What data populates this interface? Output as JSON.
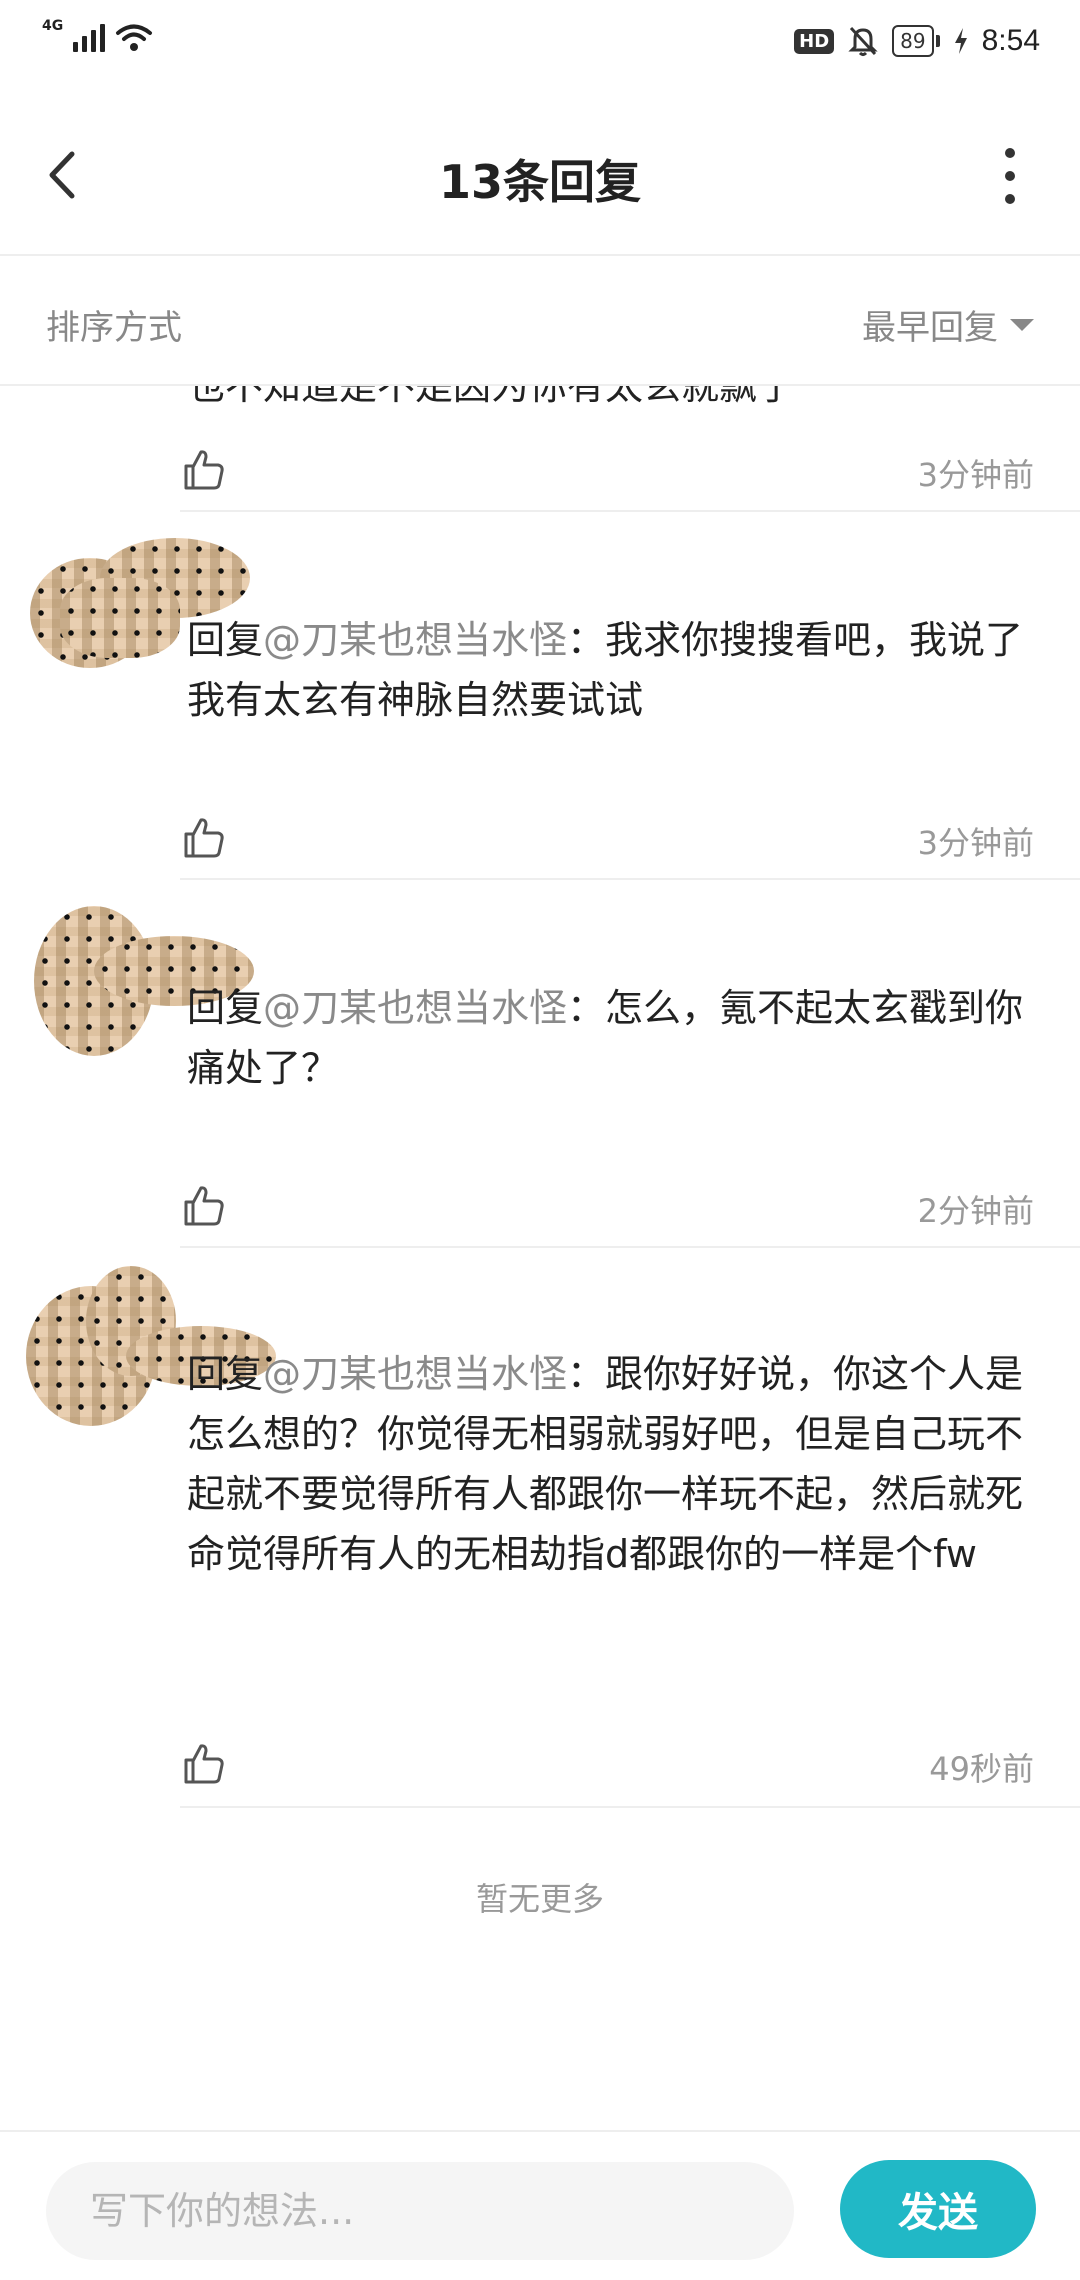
{
  "status_bar": {
    "network": "4G",
    "hd": "HD",
    "battery": "89",
    "time": "8:54",
    "icons": [
      "signal-icon",
      "wifi-icon",
      "hd-icon",
      "mute-bell-icon",
      "battery-icon",
      "charging-icon"
    ]
  },
  "header": {
    "title": "13条回复",
    "back_icon": "chevron-left-icon",
    "more_icon": "more-vertical-icon"
  },
  "sort": {
    "label": "排序方式",
    "value": "最早回复"
  },
  "comments": [
    {
      "text": "也不知道是不是因为你有太玄就飘了",
      "time": "3分钟前"
    },
    {
      "prefix": "回复",
      "mention": "@刀某也想当水怪",
      "text": "：我求你搜搜看吧，我说了我有太玄有神脉自然要试试",
      "time": "3分钟前"
    },
    {
      "prefix": "回复",
      "mention": "@刀某也想当水怪",
      "text": "：怎么，氪不起太玄戳到你痛处了？",
      "time": "2分钟前"
    },
    {
      "prefix": "回复",
      "mention": "@刀某也想当水怪",
      "text": "：跟你好好说，你这个人是怎么想的？你觉得无相弱就弱好吧，但是自己玩不起就不要觉得所有人都跟你一样玩不起，然后就死命觉得所有人的无相劫指d都跟你的一样是个fw",
      "time": "49秒前"
    }
  ],
  "no_more": "暂无更多",
  "compose": {
    "placeholder": "写下你的想法...",
    "send_label": "发送"
  },
  "colors": {
    "accent": "#21b8c6",
    "mention": "#8a8a8a",
    "muted": "#999999"
  }
}
